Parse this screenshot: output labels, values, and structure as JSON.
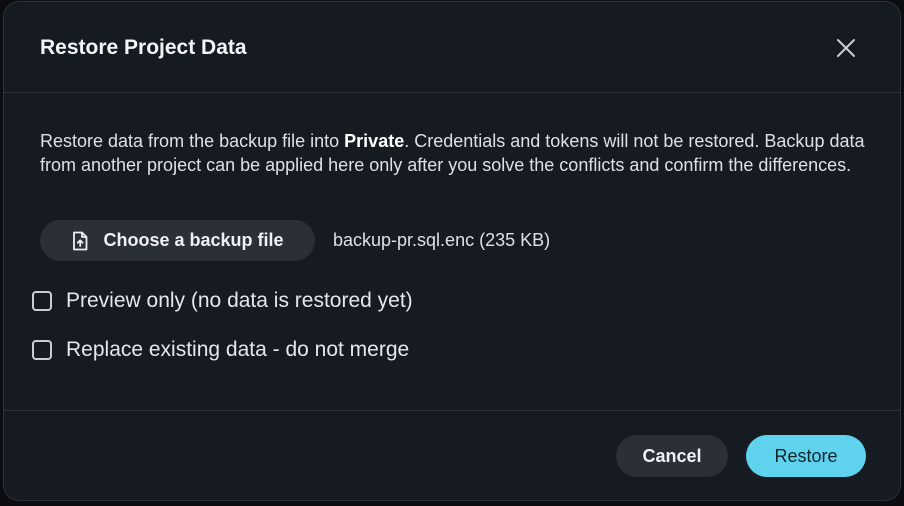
{
  "dialog": {
    "title": "Restore Project Data",
    "close_icon": "close-icon"
  },
  "body": {
    "description_part1": "Restore data from the backup file into ",
    "project_name": "Private",
    "description_part2": ". Credentials and tokens will not be restored. Backup data from another project can be applied here only after you solve the conflicts and confirm the differences.",
    "choose_file_label": "Choose a backup file",
    "upload_icon": "file-upload-icon",
    "file_name": "backup-pr.sql.enc (235 KB)",
    "options": [
      {
        "label": "Preview only (no data is restored yet)",
        "checked": false
      },
      {
        "label": "Replace existing data - do not merge",
        "checked": false
      }
    ]
  },
  "footer": {
    "cancel_label": "Cancel",
    "restore_label": "Restore"
  },
  "colors": {
    "accent": "#5fd3ee",
    "dialog_bg": "#161a21",
    "button_bg": "#2a2f38"
  }
}
